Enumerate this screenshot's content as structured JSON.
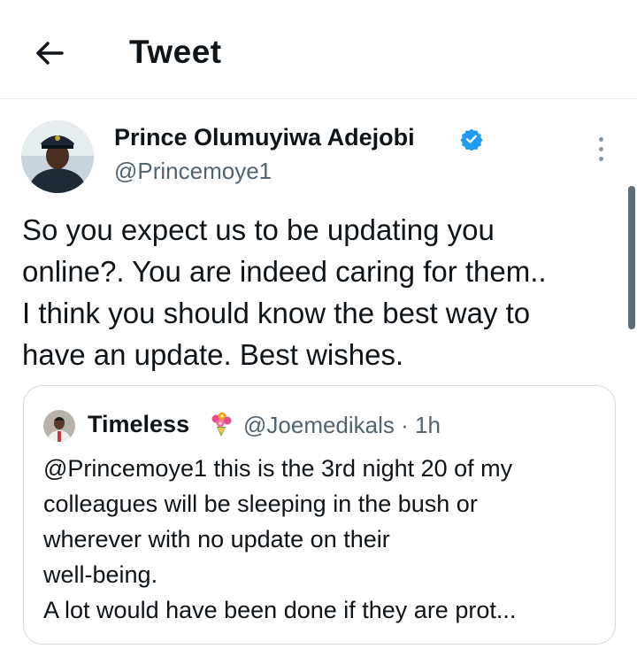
{
  "header": {
    "title": "Tweet"
  },
  "tweet": {
    "author_name": "Prince Olumuyiwa Adejobi",
    "author_handle": "@Princemoye1",
    "verified": true,
    "text": "So you expect us to be updating you\nonline?. You are indeed caring for them..\nI think you should know the best way to\nhave an update. Best wishes."
  },
  "quoted": {
    "author_name": "Timeless",
    "emoji_icon": "bouquet-icon",
    "author_handle": "@Joemedikals",
    "separator": "·",
    "time": "1h",
    "text": "@Princemoye1 this is the 3rd night 20 of my\ncolleagues will be sleeping in the bush or\nwherever with no update on their\nwell-being.\nA lot would have been done if they are prot..."
  },
  "colors": {
    "accent": "#1d9bf0",
    "secondary_text": "#536471",
    "border": "#cfd9de"
  }
}
